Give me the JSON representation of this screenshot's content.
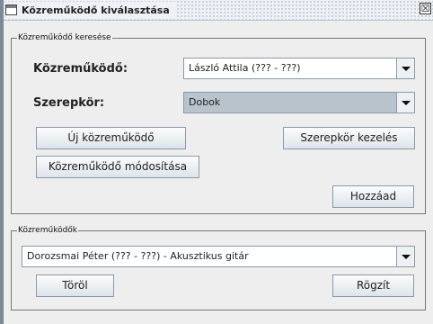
{
  "window": {
    "title": "Közreműködő kiválasztása",
    "close_glyph": "☒"
  },
  "search": {
    "legend": "Közreműködő keresése",
    "contributor_label": "Közreműködő:",
    "contributor_value": "László Attila (??? - ???)",
    "role_label": "Szerepkör:",
    "role_value": "Dobok",
    "new_button": "Új közreműködő",
    "manage_roles_button": "Szerepkör kezelés",
    "edit_button": "Közreműködő módosítása",
    "add_button": "Hozzáad"
  },
  "contributors": {
    "legend": "Közreműködők",
    "selected_value": "Dorozsmai Péter (??? - ???) - Akusztikus gitár",
    "delete_button": "Töröl",
    "save_button": "Rögzít"
  }
}
